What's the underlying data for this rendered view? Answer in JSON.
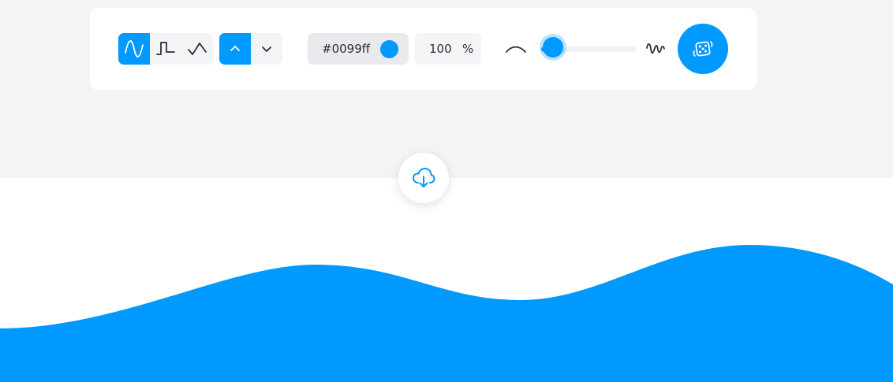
{
  "theme": {
    "accent": "#0099ff",
    "background_top": "#f3f4f6",
    "panel": "#ffffff"
  },
  "wave_type": {
    "options": [
      {
        "id": "smooth",
        "icon": "sine-wave-icon",
        "selected": true
      },
      {
        "id": "step",
        "icon": "square-wave-icon",
        "selected": false
      },
      {
        "id": "peak",
        "icon": "triangle-wave-icon",
        "selected": false
      }
    ]
  },
  "direction": {
    "options": [
      {
        "id": "up",
        "icon": "chevron-up-icon",
        "selected": true
      },
      {
        "id": "down",
        "icon": "chevron-down-icon",
        "selected": false
      }
    ]
  },
  "color": {
    "value": "#0099ff",
    "swatch": "#0099ff"
  },
  "opacity": {
    "value": "100",
    "unit": "%"
  },
  "complexity": {
    "min_icon": "smooth-curve-icon",
    "max_icon": "rough-wave-icon",
    "level": 0.12
  },
  "buttons": {
    "randomize_icon": "dice-icon",
    "download_icon": "cloud-download-icon"
  },
  "wave": {
    "fill": "#0099ff",
    "opacity": 1
  }
}
